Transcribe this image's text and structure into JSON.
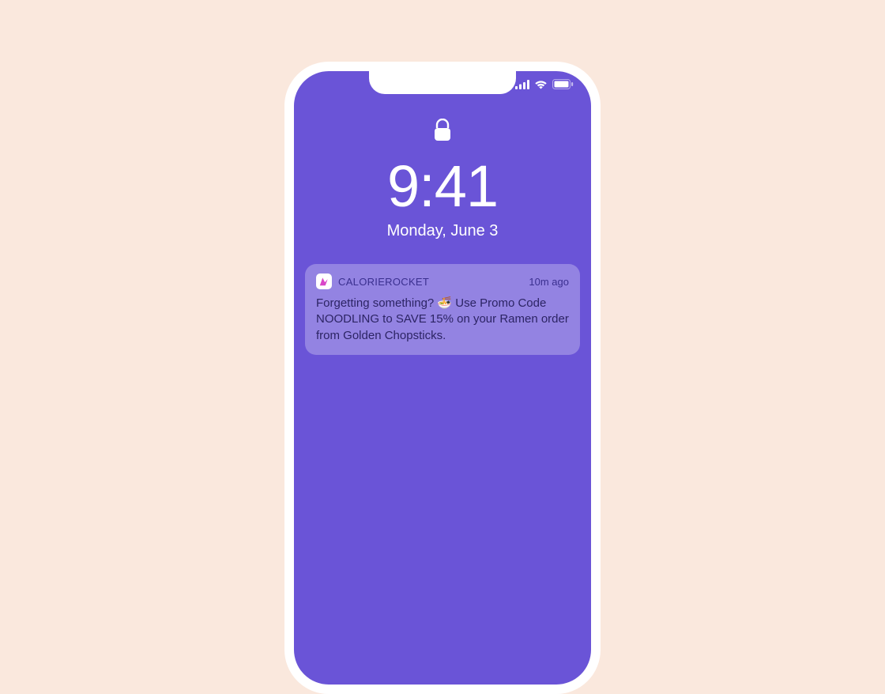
{
  "lockscreen": {
    "time": "9:41",
    "date": "Monday, June 3"
  },
  "notification": {
    "app_name": "CALORIEROCKET",
    "timestamp": "10m ago",
    "body_prefix": "Forgetting something? ",
    "emoji": "🍜",
    "body_suffix": " Use Promo Code NOODLING to SAVE 15% on your Ramen order from Golden Chopsticks."
  }
}
